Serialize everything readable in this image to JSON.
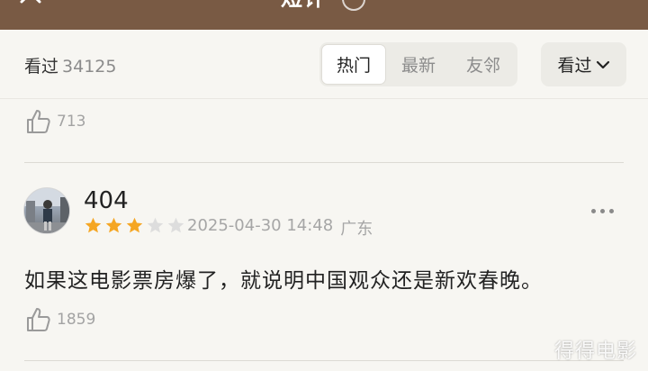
{
  "header": {
    "title": "短评"
  },
  "filter": {
    "label": "看过",
    "count": "34125",
    "tabs": [
      {
        "label": "热门",
        "active": true
      },
      {
        "label": "最新",
        "active": false
      },
      {
        "label": "友邻",
        "active": false
      }
    ],
    "dropdown_label": "看过"
  },
  "reviews": [
    {
      "likes": "713"
    },
    {
      "username": "404",
      "rating": 3,
      "rating_max": 5,
      "datetime": "2025-04-30 14:48",
      "location": "广东",
      "content": "如果这电影票房爆了，就说明中国观众还是新欢春晚。",
      "likes": "1859"
    }
  ],
  "watermark": "得得电影",
  "colors": {
    "header_bg": "#795a44",
    "star_filled": "#f5a623",
    "star_empty": "#dddddd"
  }
}
